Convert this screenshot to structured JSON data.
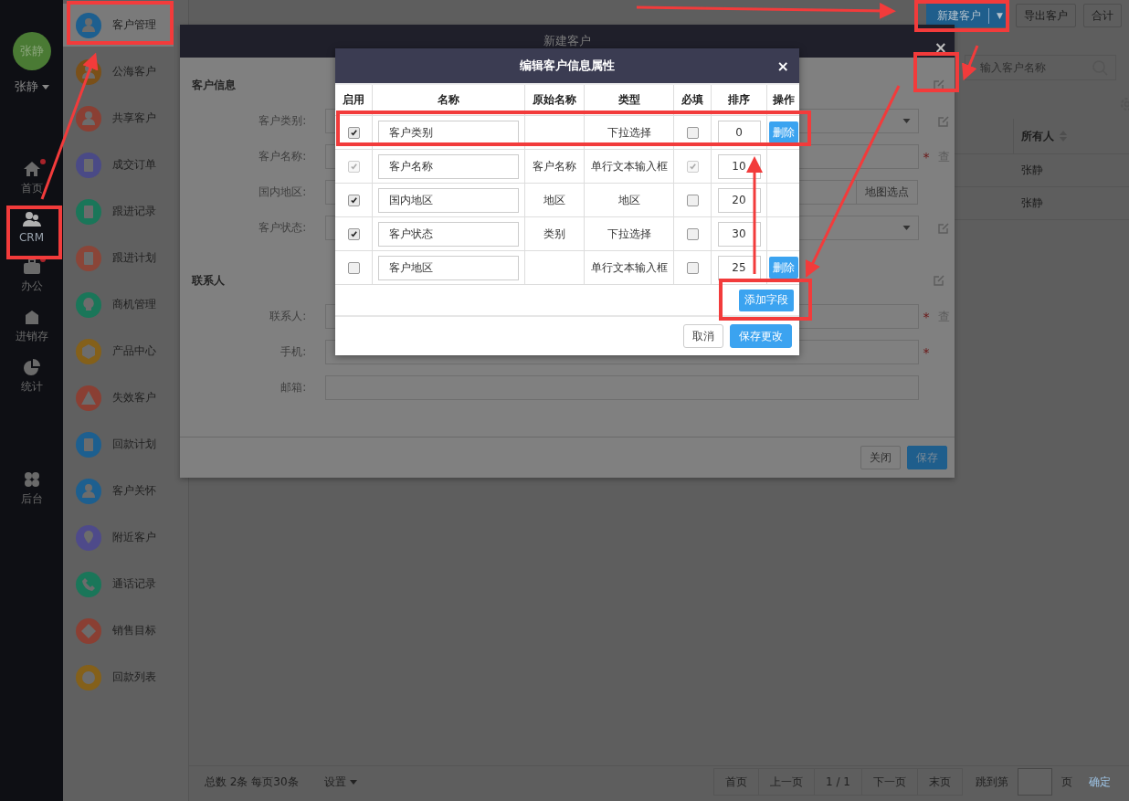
{
  "nav": {
    "avatar": "张静",
    "user_name": "张静",
    "items": [
      {
        "label": "首页",
        "badge": true,
        "selected": false
      },
      {
        "label": "CRM",
        "badge": false,
        "selected": true
      },
      {
        "label": "办公",
        "badge": true,
        "selected": false
      },
      {
        "label": "进销存",
        "badge": false,
        "selected": false
      },
      {
        "label": "统计",
        "badge": false,
        "selected": false
      }
    ],
    "bottom_items": [
      {
        "label": "后台",
        "badge": false,
        "selected": false
      }
    ]
  },
  "submenu": [
    {
      "label": "客户管理",
      "color": "#1d5f8f",
      "selected": true
    },
    {
      "label": "公海客户",
      "color": "#7a5019",
      "selected": false
    },
    {
      "label": "共享客户",
      "color": "#8a3f33",
      "selected": false
    },
    {
      "label": "成交订单",
      "color": "#4a4a86",
      "selected": false
    },
    {
      "label": "跟进记录",
      "color": "#1a7659",
      "selected": false
    },
    {
      "label": "跟进计划",
      "color": "#8a4538",
      "selected": false
    },
    {
      "label": "商机管理",
      "color": "#1a7659",
      "selected": false
    },
    {
      "label": "产品中心",
      "color": "#84601a",
      "selected": false
    },
    {
      "label": "失效客户",
      "color": "#8a3f33",
      "selected": false
    },
    {
      "label": "回款计划",
      "color": "#1d5f8f",
      "selected": false
    },
    {
      "label": "客户关怀",
      "color": "#1d5f8f",
      "selected": false
    },
    {
      "label": "附近客户",
      "color": "#4e4a8a",
      "selected": false
    },
    {
      "label": "通话记录",
      "color": "#1a7659",
      "selected": false
    },
    {
      "label": "销售目标",
      "color": "#8a3f33",
      "selected": false
    },
    {
      "label": "回款列表",
      "color": "#84601a",
      "selected": false
    }
  ],
  "toolbar": {
    "new_button": "新建客户",
    "dropdown": "▼",
    "export_button": "导出客户",
    "total_button": "合计"
  },
  "search": {
    "placeholder": "输入客户名称"
  },
  "table": {
    "columns": [
      "所有人"
    ],
    "rows": [
      {
        "owner": "张静"
      },
      {
        "owner": "张静"
      }
    ]
  },
  "footer": {
    "summary": "总数 2条 每页30条",
    "settings": "设置",
    "pages": [
      "首页",
      "上一页",
      "1 / 1",
      "下一页",
      "末页"
    ],
    "jump_label": "跳到第",
    "page_unit": "页",
    "confirm": "确定"
  },
  "new_customer_dialog": {
    "title": "新建客户",
    "close": "×",
    "sections": [
      {
        "title": "客户信息",
        "fields": [
          {
            "label": "客户类别:",
            "kind": "select",
            "editable": true
          },
          {
            "label": "客户名称:",
            "kind": "input",
            "required_mark": "*",
            "side_text": "查"
          },
          {
            "label": "国内地区:",
            "kind": "input",
            "button": "地图选点"
          },
          {
            "label": "客户状态:",
            "kind": "select",
            "editable": true
          }
        ]
      },
      {
        "title": "联系人",
        "fields": [
          {
            "label": "联系人:",
            "kind": "input",
            "required_mark": "*",
            "side_text": "查"
          },
          {
            "label": "手机:",
            "kind": "input",
            "required_mark": "*"
          },
          {
            "label": "邮箱:",
            "kind": "input"
          }
        ]
      }
    ],
    "buttons": [
      "关闭",
      "保存"
    ]
  },
  "attribute_dialog": {
    "title": "编辑客户信息属性",
    "close": "×",
    "columns": [
      "启用",
      "名称",
      "原始名称",
      "类型",
      "必填",
      "排序",
      "操作"
    ],
    "rows": [
      {
        "enabled": true,
        "name": "客户类别",
        "type": "下拉选择",
        "required": false,
        "order": "0",
        "action": "删除"
      },
      {
        "enabled": true,
        "disabled": true,
        "name": "客户名称",
        "original_name": "客户名称",
        "type": "单行文本输入框",
        "required": true,
        "order": "10"
      },
      {
        "enabled": true,
        "name": "国内地区",
        "original_name": "地区",
        "type": "地区",
        "required": false,
        "order": "20"
      },
      {
        "enabled": true,
        "name": "客户状态",
        "original_name": "类别",
        "type": "下拉选择",
        "required": false,
        "order": "30"
      },
      {
        "enabled": false,
        "name": "客户地区",
        "type": "单行文本输入框",
        "required": false,
        "order": "25",
        "action": "删除"
      }
    ],
    "add_button": "添加字段",
    "buttons": [
      "取消",
      "保存更改"
    ]
  }
}
